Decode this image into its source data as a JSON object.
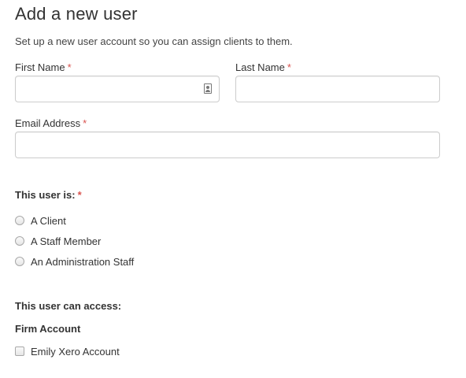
{
  "page": {
    "title": "Add a new user",
    "subtitle": "Set up a new user account so you can assign clients to them."
  },
  "form": {
    "required_marker": "*",
    "first_name": {
      "label": "First Name",
      "value": ""
    },
    "last_name": {
      "label": "Last Name",
      "value": ""
    },
    "email": {
      "label": "Email Address",
      "value": ""
    },
    "user_type": {
      "label": "This user is:",
      "options": [
        "A Client",
        "A Staff Member",
        "An Administration Staff"
      ],
      "selected": null
    },
    "access": {
      "label": "This user can access:",
      "group_label": "Firm Account",
      "accounts": [
        {
          "label": "Emily Xero Account",
          "checked": false
        }
      ]
    }
  },
  "colors": {
    "required": "#d9534f",
    "text": "#333333",
    "border": "#cccccc"
  },
  "icons": {
    "first_name_field": "contact-card-icon"
  }
}
